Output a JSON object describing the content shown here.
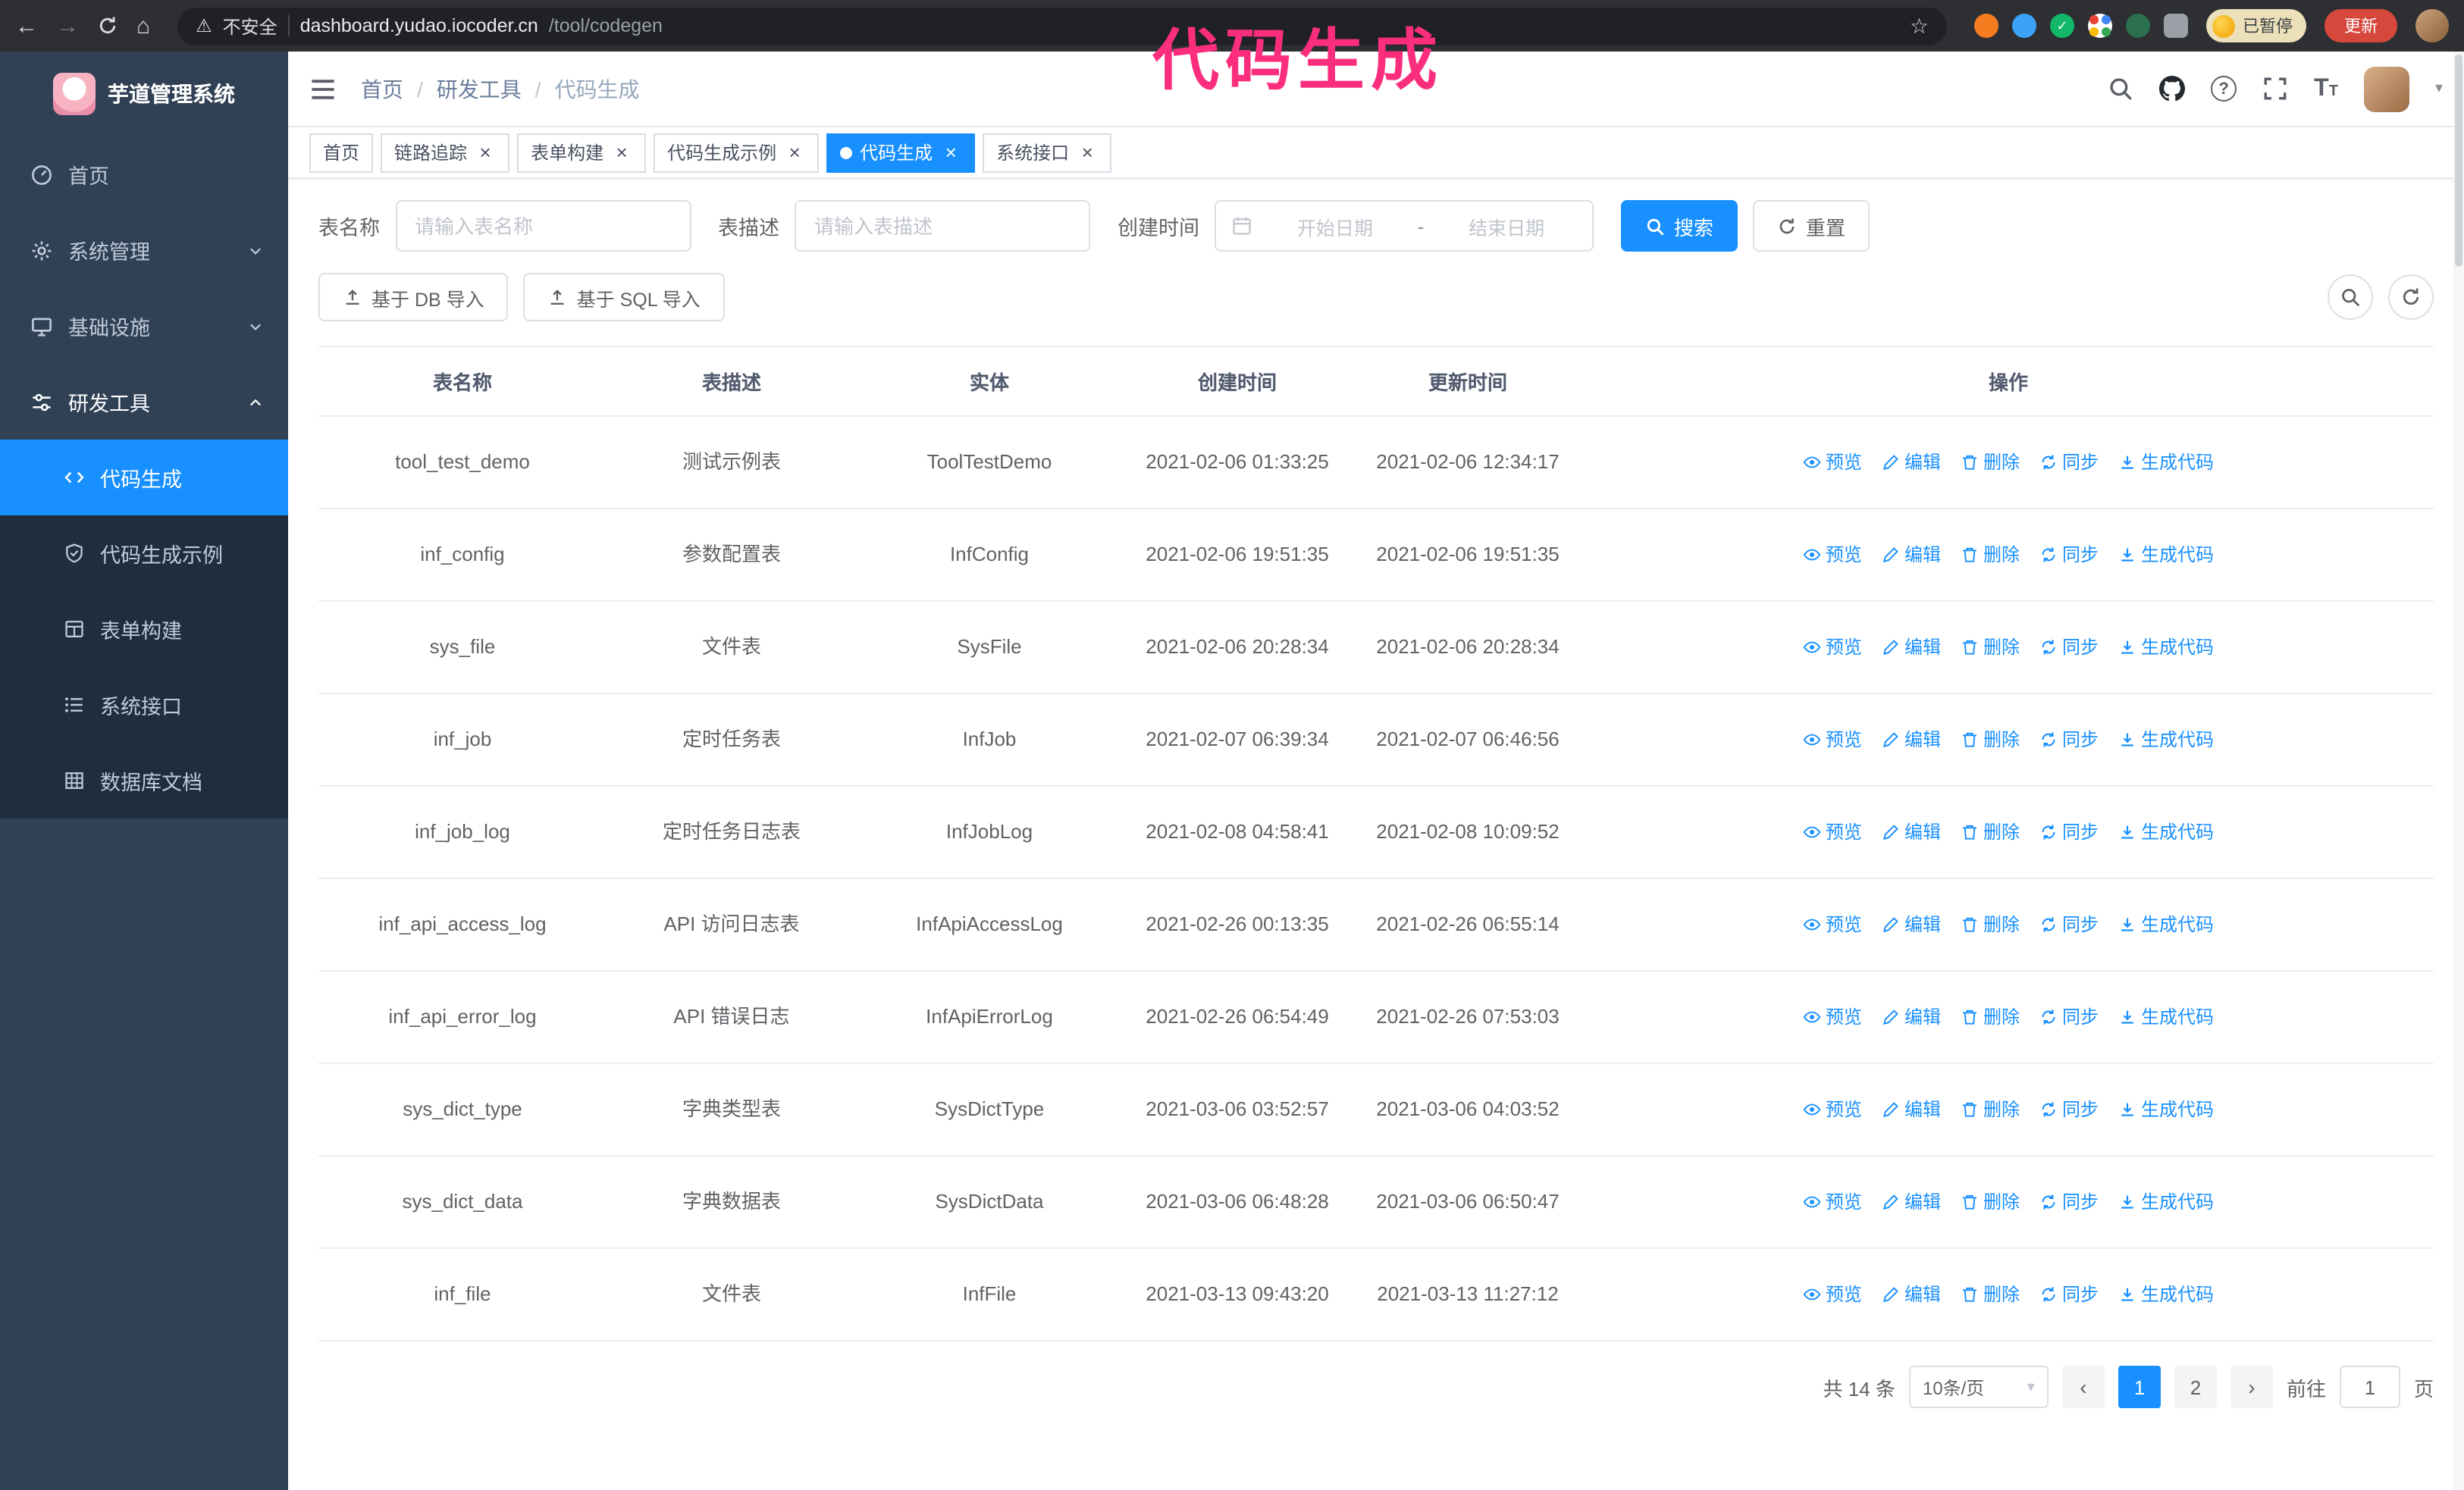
{
  "glyphs": {
    "back": "←",
    "forward": "→",
    "home": "⌂",
    "warning": "⚠",
    "star": "☆",
    "close": "×",
    "caret": "▾",
    "prev": "‹",
    "next": "›",
    "check": "✓"
  },
  "browser": {
    "security_label": "不安全",
    "url_host": "dashboard.yudao.iocoder.cn",
    "url_path": "/tool/codegen",
    "paused_badge": "已暂停",
    "update_button": "更新"
  },
  "annotation": {
    "text": "代码生成",
    "color": "#fb2e7e"
  },
  "app": {
    "title": "芋道管理系统"
  },
  "sidebar": {
    "items": [
      {
        "label": "首页"
      },
      {
        "label": "系统管理"
      },
      {
        "label": "基础设施"
      },
      {
        "label": "研发工具"
      }
    ],
    "sub_items": [
      {
        "label": "代码生成",
        "active": true
      },
      {
        "label": "代码生成示例"
      },
      {
        "label": "表单构建"
      },
      {
        "label": "系统接口"
      },
      {
        "label": "数据库文档"
      }
    ]
  },
  "breadcrumb": [
    "首页",
    "研发工具",
    "代码生成"
  ],
  "breadcrumb_separator": "/",
  "tabs": [
    {
      "label": "首页",
      "closable": false
    },
    {
      "label": "链路追踪",
      "closable": true
    },
    {
      "label": "表单构建",
      "closable": true
    },
    {
      "label": "代码生成示例",
      "closable": true
    },
    {
      "label": "代码生成",
      "closable": true,
      "active": true
    },
    {
      "label": "系统接口",
      "closable": true
    }
  ],
  "filters": {
    "table_name_label": "表名称",
    "table_name_placeholder": "请输入表名称",
    "table_desc_label": "表描述",
    "table_desc_placeholder": "请输入表描述",
    "create_time_label": "创建时间",
    "date_start_placeholder": "开始日期",
    "date_separator": "-",
    "date_end_placeholder": "结束日期",
    "search_button": "搜索",
    "reset_button": "重置"
  },
  "toolbar": {
    "import_db_button": "基于 DB 导入",
    "import_sql_button": "基于 SQL 导入"
  },
  "table": {
    "columns": [
      "表名称",
      "表描述",
      "实体",
      "创建时间",
      "更新时间",
      "操作"
    ],
    "rows": [
      {
        "name": "tool_test_demo",
        "desc": "测试示例表",
        "entity": "ToolTestDemo",
        "created": "2021-02-06 01:33:25",
        "updated": "2021-02-06 12:34:17"
      },
      {
        "name": "inf_config",
        "desc": "参数配置表",
        "entity": "InfConfig",
        "created": "2021-02-06 19:51:35",
        "updated": "2021-02-06 19:51:35"
      },
      {
        "name": "sys_file",
        "desc": "文件表",
        "entity": "SysFile",
        "created": "2021-02-06 20:28:34",
        "updated": "2021-02-06 20:28:34"
      },
      {
        "name": "inf_job",
        "desc": "定时任务表",
        "entity": "InfJob",
        "created": "2021-02-07 06:39:34",
        "updated": "2021-02-07 06:46:56"
      },
      {
        "name": "inf_job_log",
        "desc": "定时任务日志表",
        "entity": "InfJobLog",
        "created": "2021-02-08 04:58:41",
        "updated": "2021-02-08 10:09:52"
      },
      {
        "name": "inf_api_access_log",
        "desc": "API 访问日志表",
        "entity": "InfApiAccessLog",
        "created": "2021-02-26 00:13:35",
        "updated": "2021-02-26 06:55:14"
      },
      {
        "name": "inf_api_error_log",
        "desc": "API 错误日志",
        "entity": "InfApiErrorLog",
        "created": "2021-02-26 06:54:49",
        "updated": "2021-02-26 07:53:03"
      },
      {
        "name": "sys_dict_type",
        "desc": "字典类型表",
        "entity": "SysDictType",
        "created": "2021-03-06 03:52:57",
        "updated": "2021-03-06 04:03:52"
      },
      {
        "name": "sys_dict_data",
        "desc": "字典数据表",
        "entity": "SysDictData",
        "created": "2021-03-06 06:48:28",
        "updated": "2021-03-06 06:50:47"
      },
      {
        "name": "inf_file",
        "desc": "文件表",
        "entity": "InfFile",
        "created": "2021-03-13 09:43:20",
        "updated": "2021-03-13 11:27:12"
      }
    ]
  },
  "actions": {
    "preview": "预览",
    "edit": "编辑",
    "delete": "删除",
    "sync": "同步",
    "generate": "生成代码"
  },
  "pagination": {
    "total_text": "共 14 条",
    "page_size": "10条/页",
    "pages": [
      "1",
      "2"
    ],
    "goto_label": "前往",
    "goto_value": "1",
    "goto_suffix": "页"
  }
}
